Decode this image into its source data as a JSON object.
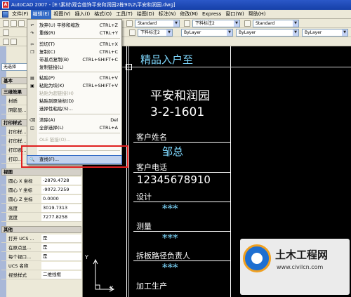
{
  "window": {
    "title": "AutoCAD 2007 - [E:\\素材\\观合值饰平安和润园2栋90\\2\\平安和润园.dwg]",
    "app_icon_letter": "A"
  },
  "menubar": {
    "items": [
      {
        "label": "文件(F)",
        "active": false
      },
      {
        "label": "编辑(E)",
        "active": true
      },
      {
        "label": "视图(V)",
        "active": false
      },
      {
        "label": "插入(I)",
        "active": false
      },
      {
        "label": "格式(O)",
        "active": false
      },
      {
        "label": "工具(T)",
        "active": false
      },
      {
        "label": "绘图(D)",
        "active": false
      },
      {
        "label": "标注(N)",
        "active": false
      },
      {
        "label": "修改(M)",
        "active": false
      },
      {
        "label": "Express",
        "active": false
      },
      {
        "label": "窗口(W)",
        "active": false
      },
      {
        "label": "帮助(H)",
        "active": false
      }
    ]
  },
  "toolbar": {
    "text_style": "Standard",
    "dim_style": "下料标注2",
    "table_style": "Standard",
    "color": "ByLayer",
    "linetype": "ByLayer",
    "lineweight": "ByLayer",
    "dim_style_2": "下料标注2"
  },
  "edit_menu": {
    "items": [
      {
        "label": "放弃(U) 平移和缩放",
        "shortcut": "CTRL+Z",
        "icon": "↶",
        "disabled": false
      },
      {
        "label": "重做(R)",
        "shortcut": "CTRL+Y",
        "icon": "↷",
        "disabled": false
      },
      {
        "label": "剪切(T)",
        "shortcut": "CTRL+X",
        "icon": "✂",
        "disabled": false
      },
      {
        "label": "复制(C)",
        "shortcut": "CTRL+C",
        "icon": "❐",
        "disabled": false
      },
      {
        "label": "带基点复制(B)",
        "shortcut": "CTRL+SHIFT+C",
        "icon": "",
        "disabled": false
      },
      {
        "label": "复制链接(L)",
        "shortcut": "",
        "icon": "",
        "disabled": false
      },
      {
        "label": "粘贴(P)",
        "shortcut": "CTRL+V",
        "icon": "▤",
        "disabled": false
      },
      {
        "label": "粘贴为块(K)",
        "shortcut": "CTRL+SHIFT+V",
        "icon": "▣",
        "disabled": false
      },
      {
        "label": "粘贴为超链接(H)",
        "shortcut": "",
        "icon": "",
        "disabled": true
      },
      {
        "label": "粘贴到原坐标(D)",
        "shortcut": "",
        "icon": "",
        "disabled": false
      },
      {
        "label": "选择性粘贴(S)...",
        "shortcut": "",
        "icon": "",
        "disabled": false
      },
      {
        "label": "清除(A)",
        "shortcut": "Del",
        "icon": "⌫",
        "disabled": false
      },
      {
        "label": "全部选择(L)",
        "shortcut": "CTRL+A",
        "icon": "◫",
        "disabled": false
      },
      {
        "label": "OLE 链接(O)...",
        "shortcut": "",
        "icon": "",
        "disabled": true
      },
      {
        "label": "查找(F)...",
        "shortcut": "",
        "icon": "🔍",
        "disabled": false
      }
    ]
  },
  "palette": {
    "selection": "无选择",
    "sections": {
      "basic": "基本",
      "3d": "三维效果",
      "plot": "打印样式",
      "view": "视图",
      "misc": "其他"
    },
    "rows_3d": [
      {
        "key": "材质",
        "value": ""
      },
      {
        "key": "阴影显...",
        "value": ""
      }
    ],
    "rows_plot": [
      {
        "key": "打印样...",
        "value": ""
      },
      {
        "key": "打印样...",
        "value": ""
      },
      {
        "key": "打印表...",
        "value": ""
      },
      {
        "key": "打印...",
        "value": ""
      }
    ],
    "rows_view": [
      {
        "key": "圆心 X 坐标",
        "value": "-2879.4728"
      },
      {
        "key": "圆心 Y 坐标",
        "value": "-9072.7259"
      },
      {
        "key": "圆心 Z 坐标",
        "value": "0.0000"
      },
      {
        "key": "高度",
        "value": "3019.7313"
      },
      {
        "key": "宽度",
        "value": "7277.8258"
      }
    ],
    "rows_misc": [
      {
        "key": "打开 UCS ...",
        "value": "是"
      },
      {
        "key": "在原点显...",
        "value": "是"
      },
      {
        "key": "每个视口...",
        "value": "是"
      },
      {
        "key": "UCS 名称",
        "value": ""
      },
      {
        "key": "视觉样式",
        "value": "二维线框"
      }
    ]
  },
  "drawing": {
    "top_partial": "精品入户至",
    "project": "平安和润园",
    "unit": "3-2-1601",
    "label_name": "客户姓名",
    "value_name": "邹总",
    "label_phone": "客户电话",
    "value_phone": "12345678910",
    "label_design": "设计",
    "value_design": "***",
    "label_measure": "测量",
    "value_measure": "***",
    "label_demolition": "拆板路径负责人",
    "value_demolition": "***",
    "label_production": "加工生产",
    "ucs_y": "Y",
    "ucs_x": "X"
  },
  "watermark": {
    "title": "土木工程网",
    "url": "www.civilcn.com"
  }
}
